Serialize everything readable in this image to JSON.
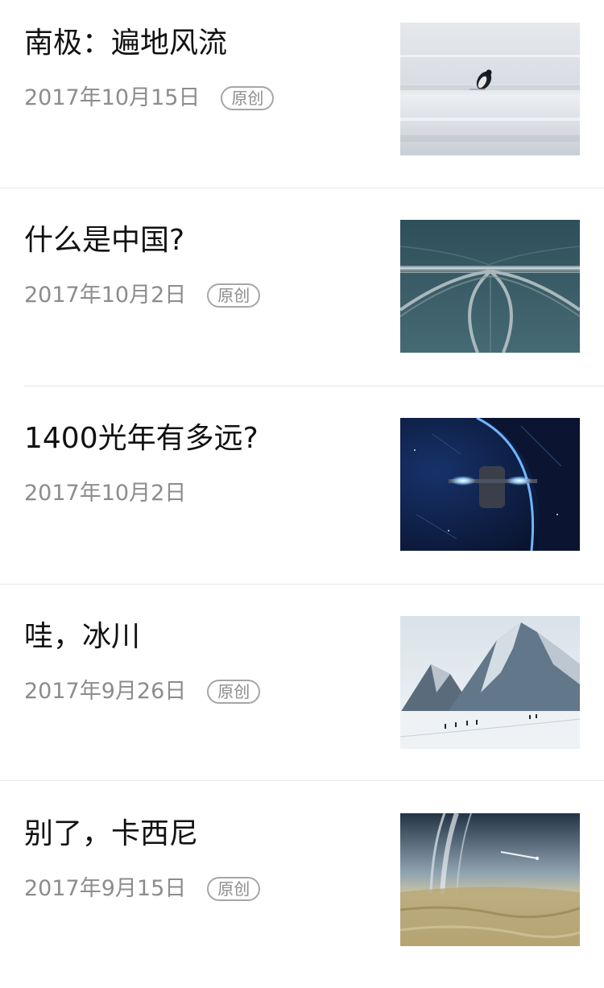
{
  "articles": [
    {
      "title": "南极：遍地风流",
      "date": "2017年10月15日",
      "badge": "原创",
      "thumbnail": "penguin-snowfield-image"
    },
    {
      "title": "什么是中国?",
      "date": "2017年10月2日",
      "badge": "原创",
      "thumbnail": "bridge-aerial-image"
    },
    {
      "title": "1400光年有多远?",
      "date": "2017年10月2日",
      "badge": "",
      "thumbnail": "spaceship-planet-image"
    },
    {
      "title": "哇，冰川",
      "date": "2017年9月26日",
      "badge": "原创",
      "thumbnail": "glacier-mountains-image"
    },
    {
      "title": "别了，卡西尼",
      "date": "2017年9月15日",
      "badge": "原创",
      "thumbnail": "saturn-rings-image"
    }
  ]
}
